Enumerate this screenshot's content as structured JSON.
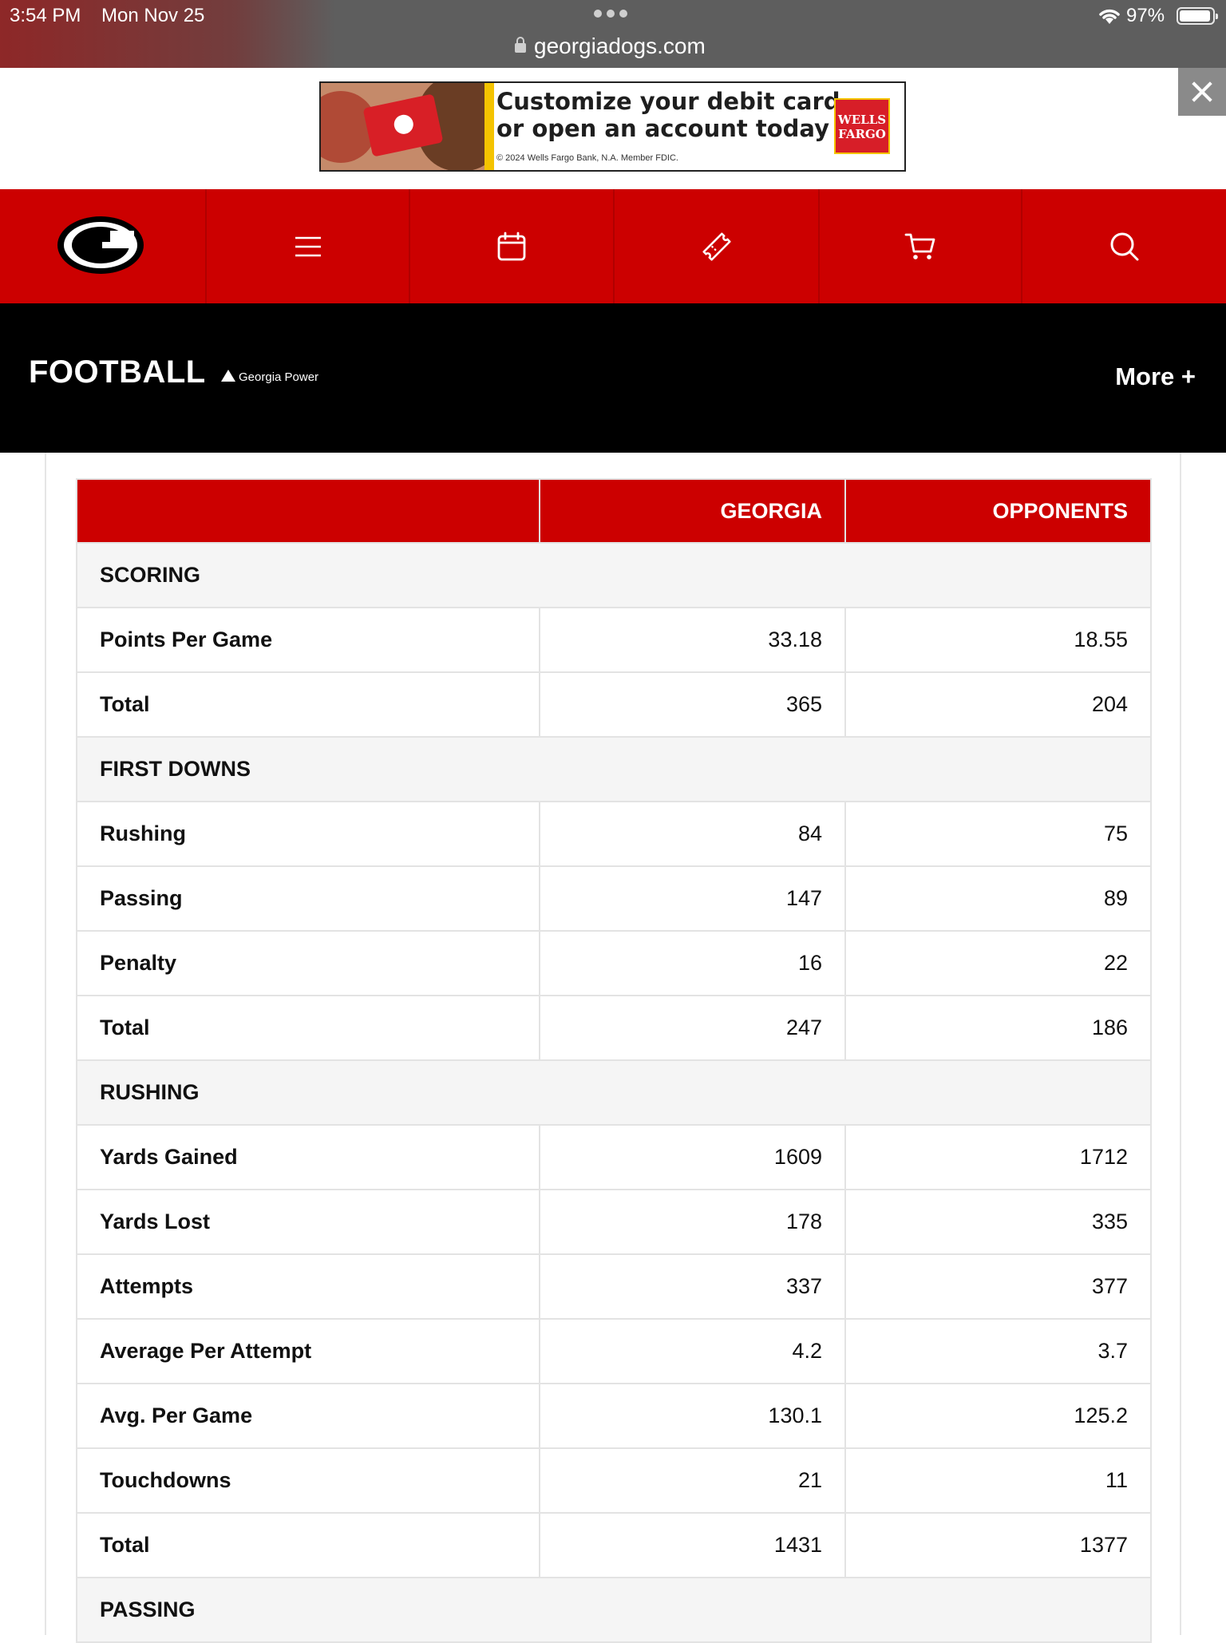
{
  "status_bar": {
    "time": "3:54 PM",
    "date": "Mon Nov 25",
    "url": "georgiadogs.com",
    "battery": "97%"
  },
  "ad": {
    "line1": "Customize your debit card",
    "line2": "or open an account today",
    "fine_print": "© 2024 Wells Fargo Bank, N.A. Member FDIC.",
    "brand_line1": "WELLS",
    "brand_line2": "FARGO"
  },
  "nav": {
    "icons": [
      "georgia-g-logo",
      "menu-icon",
      "calendar-icon",
      "ticket-icon",
      "cart-icon",
      "search-icon"
    ]
  },
  "sport_bar": {
    "title": "FOOTBALL",
    "sponsor": "Georgia Power",
    "more": "More +"
  },
  "table": {
    "headers": [
      "",
      "GEORGIA",
      "OPPONENTS"
    ],
    "rows": [
      {
        "type": "section",
        "label": "SCORING"
      },
      {
        "type": "data",
        "label": "Points Per Game",
        "georgia": "33.18",
        "opponents": "18.55"
      },
      {
        "type": "data",
        "label": "Total",
        "georgia": "365",
        "opponents": "204"
      },
      {
        "type": "section",
        "label": "FIRST DOWNS"
      },
      {
        "type": "data",
        "label": "Rushing",
        "georgia": "84",
        "opponents": "75"
      },
      {
        "type": "data",
        "label": "Passing",
        "georgia": "147",
        "opponents": "89"
      },
      {
        "type": "data",
        "label": "Penalty",
        "georgia": "16",
        "opponents": "22"
      },
      {
        "type": "data",
        "label": "Total",
        "georgia": "247",
        "opponents": "186"
      },
      {
        "type": "section",
        "label": "RUSHING"
      },
      {
        "type": "data",
        "label": "Yards Gained",
        "georgia": "1609",
        "opponents": "1712"
      },
      {
        "type": "data",
        "label": "Yards Lost",
        "georgia": "178",
        "opponents": "335"
      },
      {
        "type": "data",
        "label": "Attempts",
        "georgia": "337",
        "opponents": "377"
      },
      {
        "type": "data",
        "label": "Average Per Attempt",
        "georgia": "4.2",
        "opponents": "3.7"
      },
      {
        "type": "data",
        "label": "Avg. Per Game",
        "georgia": "130.1",
        "opponents": "125.2"
      },
      {
        "type": "data",
        "label": "Touchdowns",
        "georgia": "21",
        "opponents": "11"
      },
      {
        "type": "data",
        "label": "Total",
        "georgia": "1431",
        "opponents": "1377"
      },
      {
        "type": "section",
        "label": "PASSING"
      }
    ]
  },
  "colors": {
    "brand_red": "#cc0000",
    "header_black": "#000000",
    "status_gray": "#5e5e5e"
  }
}
